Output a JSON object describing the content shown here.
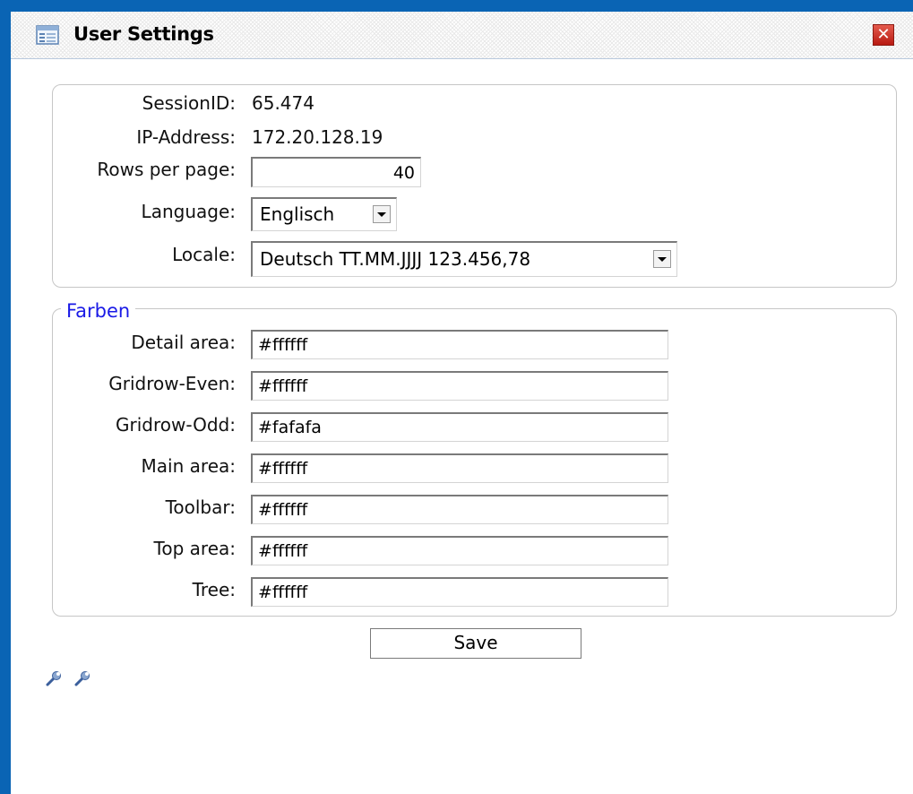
{
  "window": {
    "title": "User Settings",
    "close_symbol": "✕"
  },
  "session": {
    "session_id_label": "SessionID:",
    "session_id_value": "65.474",
    "ip_label": "IP-Address:",
    "ip_value": "172.20.128.19",
    "rows_label": "Rows per page:",
    "rows_value": "40",
    "language_label": "Language:",
    "language_value": "Englisch",
    "locale_label": "Locale:",
    "locale_value": "Deutsch TT.MM.JJJJ 123.456,78"
  },
  "colors_section": {
    "legend": "Farben",
    "rows": [
      {
        "label": "Detail area:",
        "value": "#ffffff"
      },
      {
        "label": "Gridrow-Even:",
        "value": "#ffffff"
      },
      {
        "label": "Gridrow-Odd:",
        "value": "#fafafa"
      },
      {
        "label": "Main area:",
        "value": "#ffffff"
      },
      {
        "label": "Toolbar:",
        "value": "#ffffff"
      },
      {
        "label": "Top area:",
        "value": "#ffffff"
      },
      {
        "label": "Tree:",
        "value": "#ffffff"
      }
    ]
  },
  "actions": {
    "save_label": "Save"
  },
  "icons": [
    "settings-window-icon",
    "close-icon",
    "wrench-icon",
    "wrench-icon"
  ],
  "theme": {
    "desktop_background": "#0a64b4",
    "legend_color": "#1a1ae6",
    "close_button_color": "#c8322a"
  }
}
